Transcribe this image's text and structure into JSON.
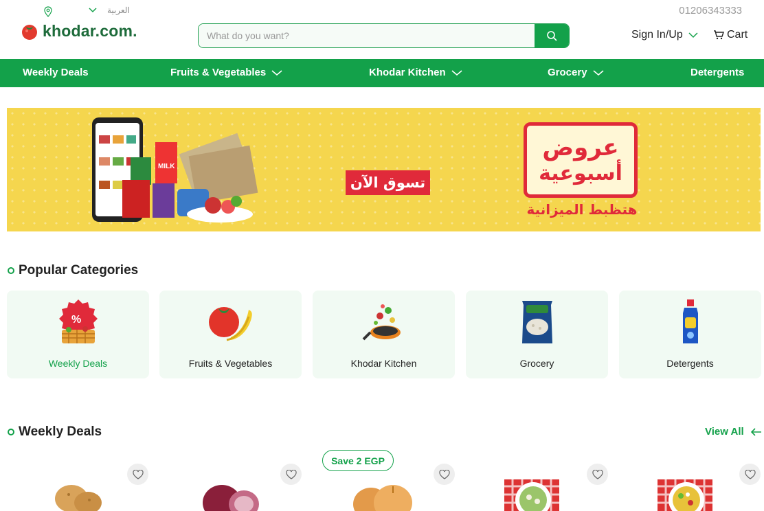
{
  "header": {
    "language_label": "العربية",
    "phone": "01206343333",
    "logo_text": "khodar.com.",
    "search_placeholder": "What do you want?",
    "signin_label": "Sign In/Up",
    "cart_label": "Cart"
  },
  "nav": {
    "items": [
      {
        "label": "Weekly Deals"
      },
      {
        "label": "Fruits & Vegetables"
      },
      {
        "label": "Khodar Kitchen"
      },
      {
        "label": "Grocery"
      },
      {
        "label": "Detergents"
      }
    ]
  },
  "banner": {
    "shop_now": "تسوق الآن",
    "offer_line1": "عروض",
    "offer_line2": "أسبوعية",
    "offer_sub": "هتظبط الميزانية",
    "milk_label": "MILK"
  },
  "popular": {
    "title": "Popular Categories",
    "categories": [
      {
        "label": "Weekly Deals"
      },
      {
        "label": "Fruits & Vegetables"
      },
      {
        "label": "Khodar Kitchen"
      },
      {
        "label": "Grocery"
      },
      {
        "label": "Detergents"
      }
    ]
  },
  "weekly": {
    "title": "Weekly Deals",
    "view_all": "View All",
    "save_badge": "Save 2 EGP"
  },
  "colors": {
    "brand_green": "#13a14a",
    "banner_yellow": "#f5d64e",
    "offer_red": "#e02a3a"
  }
}
